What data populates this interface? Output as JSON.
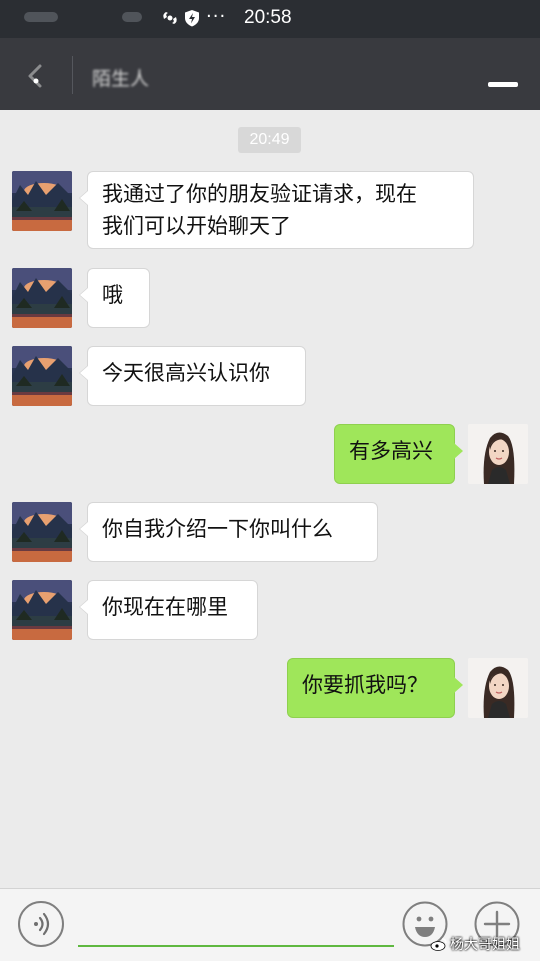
{
  "status_bar": {
    "time": "20:58",
    "dots": "···",
    "icons": [
      "blurred-carrier",
      "blurred-signal",
      "sync-icon",
      "shield-charge-icon"
    ]
  },
  "header": {
    "title": "陌生人",
    "back_icon": "back-arrow-icon",
    "menu_icon": "menu-icon"
  },
  "conversation": {
    "timestamp": "20:49",
    "messages": [
      {
        "from": "them",
        "lines": [
          "我通过了你的朋友验证请求，现在",
          "我们可以开始聊天了"
        ]
      },
      {
        "from": "them",
        "lines": [
          "哦"
        ]
      },
      {
        "from": "them",
        "lines": [
          "今天很高兴认识你"
        ]
      },
      {
        "from": "me",
        "lines": [
          "有多高兴"
        ]
      },
      {
        "from": "them",
        "lines": [
          "你自我介绍一下你叫什么"
        ]
      },
      {
        "from": "them",
        "lines": [
          "你现在在哪里"
        ]
      },
      {
        "from": "me",
        "lines": [
          "你要抓我吗？"
        ]
      }
    ]
  },
  "input_bar": {
    "voice_icon": "voice-icon",
    "emoji_icon": "emoji-icon",
    "more_icon": "plus-icon",
    "input_value": ""
  },
  "watermark": {
    "text": "杨大哥姐姐"
  },
  "colors": {
    "status_bar": "#2b2e33",
    "title_bar": "#393a3f",
    "chat_background": "#ebebeb",
    "bubble_me": "#9fe65a",
    "bubble_them": "#ffffff",
    "input_underline": "#5fb840"
  }
}
